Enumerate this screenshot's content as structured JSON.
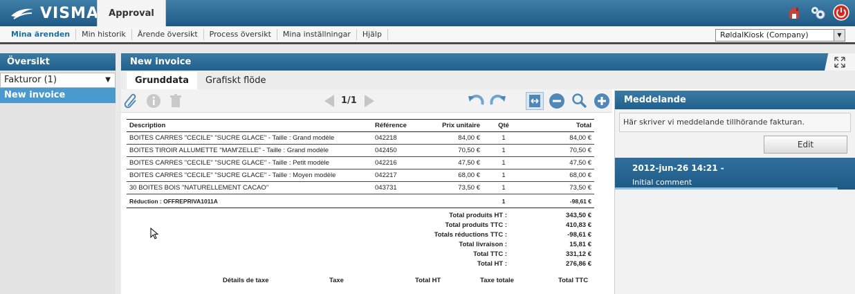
{
  "brand": {
    "logo_text": "VISMA",
    "app_tab": "Approval"
  },
  "top_icons": [
    "home-icon",
    "settings-gear-icon",
    "power-icon"
  ],
  "menu": {
    "items": [
      "Mina ärenden",
      "Min historik",
      "Ärende översikt",
      "Process översikt",
      "Mina inställningar",
      "Hjälp"
    ],
    "company": "RøldalKiosk (Company)"
  },
  "left": {
    "title": "Översikt",
    "filter": "Fakturor (1)",
    "selected_item": "New invoice"
  },
  "main": {
    "title": "New invoice",
    "tabs": [
      "Grunddata",
      "Grafiskt flöde"
    ],
    "page": "1/1"
  },
  "invoice": {
    "headers": [
      "Description",
      "Référence",
      "Prix unitaire",
      "Qté",
      "Total"
    ],
    "rows": [
      [
        "BOITES CARRES \"CECILE\"  \"SUCRE GLACE\" - Taille : Grand modèle",
        "042218",
        "84,00 €",
        "1",
        "84,00 €"
      ],
      [
        "BOITES TIROIR ALLUMETTE  \"MAM'ZELLE\" - Taille : Grand modèle",
        "042450",
        "70,50 €",
        "1",
        "70,50 €"
      ],
      [
        "BOITES CARRES \"CECILE\"  \"SUCRE GLACE\" - Taille : Petit modèle",
        "042216",
        "47,50 €",
        "1",
        "47,50 €"
      ],
      [
        "BOITES CARRES \"CECILE\"  \"SUCRE GLACE\" - Taille : Moyen modèle",
        "042217",
        "68,00 €",
        "1",
        "68,00 €"
      ],
      [
        "30 BOITES BOIS  \"NATURELLEMENT CACAO\"",
        "043731",
        "73,50 €",
        "1",
        "73,50 €"
      ]
    ],
    "reduction": {
      "label": "Réduction : OFFREPRIVA1011A",
      "qty": "1",
      "total": "-98,61 €"
    },
    "totals": [
      {
        "label": "Total produits HT :",
        "value": "343,50 €"
      },
      {
        "label": "Total produits TTC :",
        "value": "410,83 €"
      },
      {
        "label": "Totals réductions TTC :",
        "value": "-98,61 €"
      },
      {
        "label": "Total livraison :",
        "value": "15,81 €"
      },
      {
        "label": "Total TTC :",
        "value": "331,12 €"
      },
      {
        "label": "Total HT :",
        "value": "276,86 €"
      }
    ],
    "tax_headers": [
      "Détails de taxe",
      "Taxe",
      "Total HT",
      "Taxe totale",
      "Total TTC"
    ]
  },
  "right": {
    "title": "Meddelande",
    "message": "Här skriver vi meddelande tillhörande fakturan.",
    "edit_label": "Edit",
    "comment_date": "2012-jun-26 14:21 -",
    "comment_text": "Initial comment"
  }
}
